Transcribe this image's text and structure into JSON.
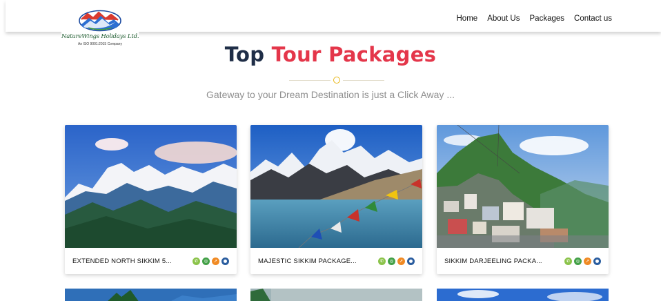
{
  "header": {
    "logo": {
      "name": "NatureWings Holidays Ltd.",
      "certification": "An ISO 9001:2015 Company"
    },
    "nav": [
      "Home",
      "About Us",
      "Packages",
      "Contact us"
    ]
  },
  "section": {
    "title_part1": "Top",
    "title_part2": "Tour Packages",
    "subtitle": "Gateway to your Dream Destination is just a Click Away ..."
  },
  "packages": [
    {
      "title": "EXTENDED NORTH SIKKIM 5...",
      "icons": [
        "phone-icon",
        "whatsapp-icon",
        "compass-icon",
        "location-icon"
      ]
    },
    {
      "title": "MAJESTIC SIKKIM PACKAGE...",
      "icons": [
        "phone-icon",
        "whatsapp-icon",
        "compass-icon",
        "location-icon"
      ]
    },
    {
      "title": "SIKKIM DARJEELING PACKA...",
      "icons": [
        "phone-icon",
        "whatsapp-icon",
        "compass-icon",
        "location-icon"
      ]
    }
  ],
  "colors": {
    "title_dark": "#1f2e47",
    "title_accent": "#e4364a",
    "divider_dot": "#e9b81b"
  }
}
